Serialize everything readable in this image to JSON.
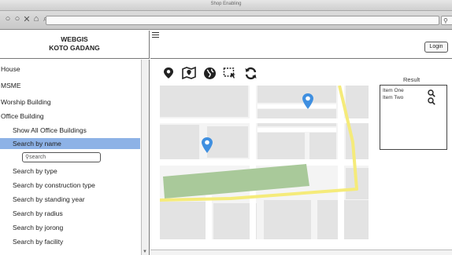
{
  "window": {
    "title": "Shop Enabling",
    "address_value": "",
    "nav_icons": [
      "back-icon",
      "forward-icon",
      "close-icon",
      "home-icon",
      "link-icon"
    ]
  },
  "app": {
    "brand_line1": "WEBGIS",
    "brand_line2": "KOTO GADANG",
    "login_label": "Login"
  },
  "sidebar": {
    "items": [
      {
        "label": "House"
      },
      {
        "label": "MSME"
      },
      {
        "label": "Worship Building"
      },
      {
        "label": "Office Building"
      }
    ],
    "sub_items": [
      {
        "label": "Show All Office Buildings"
      },
      {
        "label": "Search by name",
        "active": true
      },
      {
        "label": "Search by type"
      },
      {
        "label": "Search by construction type"
      },
      {
        "label": "Search by standing year"
      },
      {
        "label": "Search by radius"
      },
      {
        "label": "Search by jorong"
      },
      {
        "label": "Search by facility"
      }
    ],
    "search_placeholder": "search"
  },
  "toolbar": {
    "tools": [
      "map-pin-icon",
      "map-search-icon",
      "globe-icon",
      "select-area-icon",
      "refresh-icon"
    ]
  },
  "result": {
    "label": "Result",
    "items": [
      {
        "label": "Item One"
      },
      {
        "label": "Item Two"
      }
    ]
  },
  "colors": {
    "accent_active": "#8db2e6",
    "map_road": "#ffffff",
    "map_block": "#e3e3e3",
    "map_park": "#a9c99a",
    "map_highway": "#f5eb7a",
    "pin": "#3f8fe0"
  }
}
